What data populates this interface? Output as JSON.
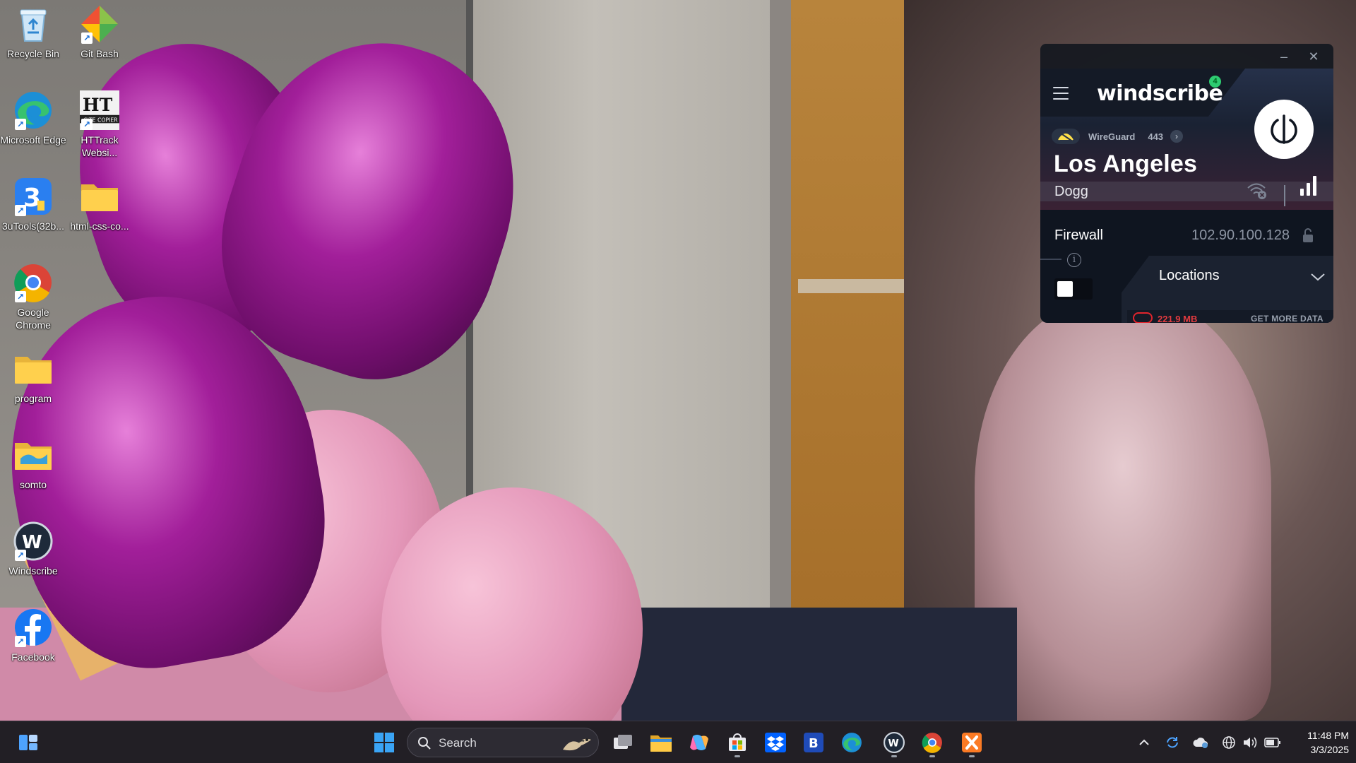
{
  "desktop": {
    "icons": [
      {
        "label": "Recycle Bin",
        "icon": "recycle-bin-icon"
      },
      {
        "label": "Git Bash",
        "icon": "git-bash-icon"
      },
      {
        "label": "Microsoft Edge",
        "icon": "edge-icon"
      },
      {
        "label": "HTTrack Websi...",
        "icon": "httrack-icon"
      },
      {
        "label": "3uTools(32b...",
        "icon": "3utools-icon"
      },
      {
        "label": "html-css-co...",
        "icon": "folder-icon"
      },
      {
        "label": "Google Chrome",
        "icon": "chrome-icon"
      },
      {
        "label": "program",
        "icon": "folder-icon"
      },
      {
        "label": "somto",
        "icon": "folder-icon"
      },
      {
        "label": "Windscribe",
        "icon": "windscribe-icon"
      },
      {
        "label": "Facebook",
        "icon": "facebook-icon"
      }
    ]
  },
  "windscribe": {
    "logo": "windscribe",
    "notification_count": "4",
    "protocol": "WireGuard",
    "port": "443",
    "city": "Los Angeles",
    "node": "Dogg",
    "firewall_label": "Firewall",
    "ip": "102.90.100.128",
    "locations_label": "Locations",
    "data_amount": "221.9 MB",
    "data_cta": "GET MORE DATA",
    "firewall_on": false,
    "signal_bars": 3,
    "colors": {
      "accent": "#2ecc71",
      "data_warning": "#e23a3f",
      "panel": "#0f1520"
    }
  },
  "taskbar": {
    "search_placeholder": "Search",
    "apps": [
      "start",
      "search",
      "task-view",
      "file-explorer",
      "copilot",
      "microsoft-store",
      "dropbox",
      "b-app",
      "edge",
      "windscribe",
      "chrome",
      "xampp"
    ],
    "clock_time": "11:48 PM",
    "clock_date": "3/3/2025"
  }
}
